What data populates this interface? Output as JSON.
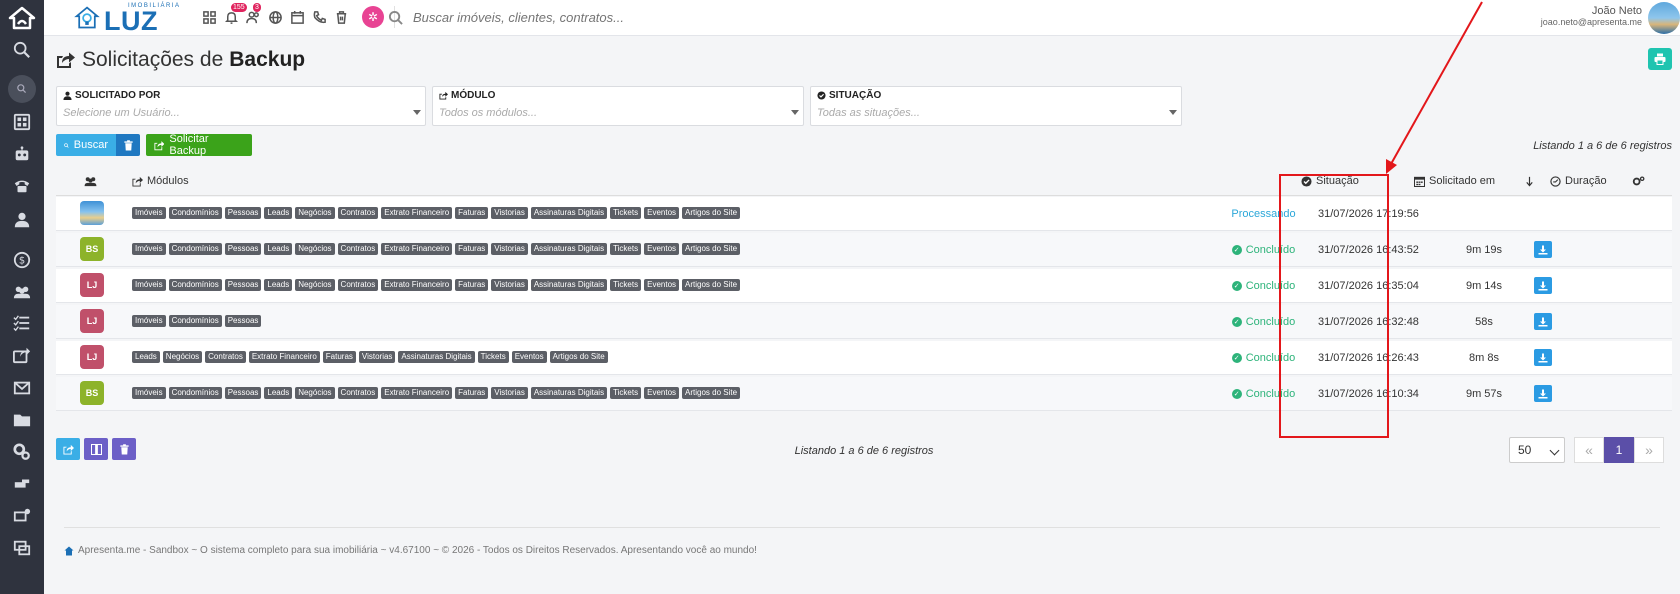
{
  "topbar": {
    "brand_sub": "IMOBILIÁRIA",
    "brand_name": "LUZ",
    "notif_count": "155",
    "people_count": "3",
    "search_placeholder": "Buscar imóveis, clientes, contratos...",
    "user_name": "João Neto",
    "user_email": "joao.neto@apresenta.me"
  },
  "page": {
    "title_prefix": "Solicitações de",
    "title_bold": "Backup"
  },
  "filters": {
    "requested_by": {
      "label": "SOLICITADO POR",
      "placeholder": "Selecione um Usuário..."
    },
    "module": {
      "label": "MÓDULO",
      "placeholder": "Todos os módulos..."
    },
    "status": {
      "label": "SITUAÇÃO",
      "placeholder": "Todas as situações..."
    }
  },
  "actions": {
    "search_label": "Buscar",
    "request_label": "Solicitar Backup"
  },
  "listing_text": "Listando 1 a 6 de 6 registros",
  "table": {
    "headers": {
      "modules": "Módulos",
      "status": "Situação",
      "requested_at": "Solicitado em",
      "duration": "Duração"
    },
    "rows": [
      {
        "avatar": "",
        "avatar_type": "photo",
        "avatar_color": "",
        "modules": [
          "Imóveis",
          "Condomínios",
          "Pessoas",
          "Leads",
          "Negócios",
          "Contratos",
          "Extrato Financeiro",
          "Faturas",
          "Vistorias",
          "Assinaturas Digitais",
          "Tickets",
          "Eventos",
          "Artigos do Site"
        ],
        "status": "Processando",
        "status_type": "processing",
        "date": "31/07/2026 17:19:56",
        "duration": ""
      },
      {
        "avatar": "BS",
        "avatar_type": "initials",
        "avatar_color": "#8db32a",
        "modules": [
          "Imóveis",
          "Condomínios",
          "Pessoas",
          "Leads",
          "Negócios",
          "Contratos",
          "Extrato Financeiro",
          "Faturas",
          "Vistorias",
          "Assinaturas Digitais",
          "Tickets",
          "Eventos",
          "Artigos do Site"
        ],
        "status": "Concluído",
        "status_type": "done",
        "date": "31/07/2026 16:43:52",
        "duration": "9m 19s"
      },
      {
        "avatar": "LJ",
        "avatar_type": "initials",
        "avatar_color": "#c0506a",
        "modules": [
          "Imóveis",
          "Condomínios",
          "Pessoas",
          "Leads",
          "Negócios",
          "Contratos",
          "Extrato Financeiro",
          "Faturas",
          "Vistorias",
          "Assinaturas Digitais",
          "Tickets",
          "Eventos",
          "Artigos do Site"
        ],
        "status": "Concluído",
        "status_type": "done",
        "date": "31/07/2026 16:35:04",
        "duration": "9m 14s"
      },
      {
        "avatar": "LJ",
        "avatar_type": "initials",
        "avatar_color": "#c0506a",
        "modules": [
          "Imóveis",
          "Condomínios",
          "Pessoas"
        ],
        "status": "Concluído",
        "status_type": "done",
        "date": "31/07/2026 16:32:48",
        "duration": "58s"
      },
      {
        "avatar": "LJ",
        "avatar_type": "initials",
        "avatar_color": "#c0506a",
        "modules": [
          "Leads",
          "Negócios",
          "Contratos",
          "Extrato Financeiro",
          "Faturas",
          "Vistorias",
          "Assinaturas Digitais",
          "Tickets",
          "Eventos",
          "Artigos do Site"
        ],
        "status": "Concluído",
        "status_type": "done",
        "date": "31/07/2026 16:26:43",
        "duration": "8m 8s"
      },
      {
        "avatar": "BS",
        "avatar_type": "initials",
        "avatar_color": "#8db32a",
        "modules": [
          "Imóveis",
          "Condomínios",
          "Pessoas",
          "Leads",
          "Negócios",
          "Contratos",
          "Extrato Financeiro",
          "Faturas",
          "Vistorias",
          "Assinaturas Digitais",
          "Tickets",
          "Eventos",
          "Artigos do Site"
        ],
        "status": "Concluído",
        "status_type": "done",
        "date": "31/07/2026 16:10:34",
        "duration": "9m 57s"
      }
    ]
  },
  "pagination": {
    "per_page": "50",
    "current_page": "1"
  },
  "footer": "Apresenta.me - Sandbox ~ O sistema completo para sua imobiliária ~ v4.67100 ~ © 2026 - Todos os Direitos Reservados. Apresentando você ao mundo!",
  "colors": {
    "sidebar": "#2f333e",
    "brand": "#1b6fb5",
    "success": "#2db37a",
    "processing": "#2ba7d9",
    "annotation": "#e3171b"
  }
}
